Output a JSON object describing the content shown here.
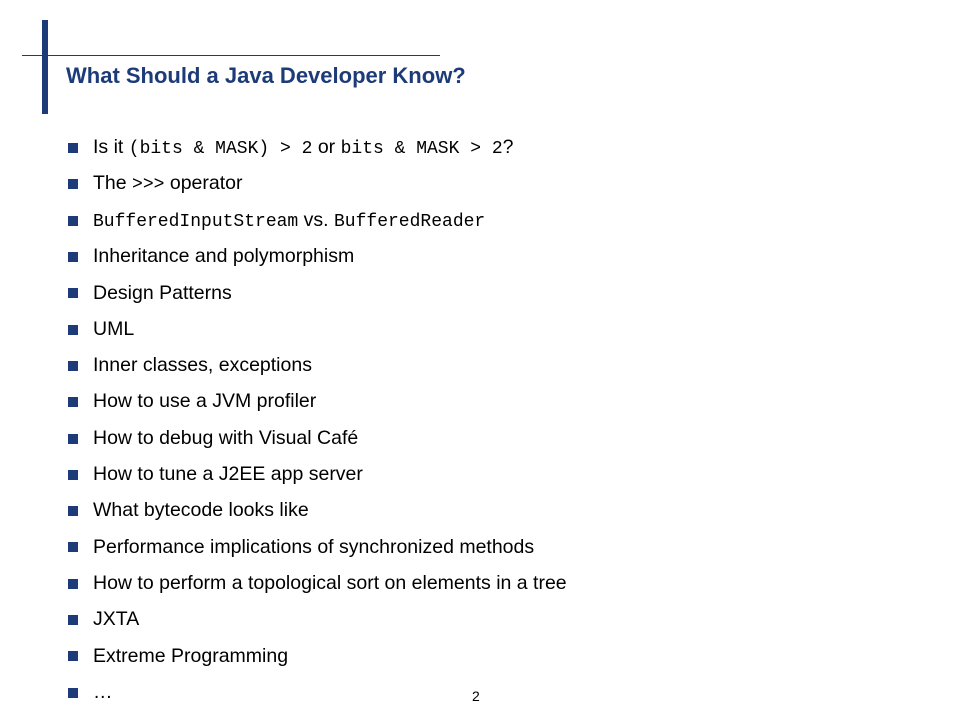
{
  "slide": {
    "title": "What Should a Java Developer Know?",
    "page_number": "2",
    "accent_color": "#1c3b78",
    "bullets": [
      {
        "parts": [
          {
            "text": "Is it ",
            "mono": false
          },
          {
            "text": "(bits & MASK) > 2",
            "mono": true
          },
          {
            "text": " or ",
            "mono": false
          },
          {
            "text": "bits & MASK > 2",
            "mono": true
          },
          {
            "text": "?",
            "mono": false
          }
        ]
      },
      {
        "parts": [
          {
            "text": "The ",
            "mono": false
          },
          {
            "text": ">>>",
            "mono": true
          },
          {
            "text": " operator",
            "mono": false
          }
        ]
      },
      {
        "parts": [
          {
            "text": "BufferedInputStream",
            "mono": true
          },
          {
            "text": " vs. ",
            "mono": false
          },
          {
            "text": "BufferedReader",
            "mono": true
          }
        ]
      },
      {
        "parts": [
          {
            "text": "Inheritance and polymorphism",
            "mono": false
          }
        ]
      },
      {
        "parts": [
          {
            "text": "Design Patterns",
            "mono": false
          }
        ]
      },
      {
        "parts": [
          {
            "text": "UML",
            "mono": false
          }
        ]
      },
      {
        "parts": [
          {
            "text": "Inner classes, exceptions",
            "mono": false
          }
        ]
      },
      {
        "parts": [
          {
            "text": "How to use a JVM profiler",
            "mono": false
          }
        ]
      },
      {
        "parts": [
          {
            "text": "How to debug with Visual Café",
            "mono": false
          }
        ]
      },
      {
        "parts": [
          {
            "text": "How to tune a J2EE app server",
            "mono": false
          }
        ]
      },
      {
        "parts": [
          {
            "text": "What bytecode looks like",
            "mono": false
          }
        ]
      },
      {
        "parts": [
          {
            "text": "Performance implications of synchronized methods",
            "mono": false
          }
        ]
      },
      {
        "parts": [
          {
            "text": "How to perform a topological sort on elements in a tree",
            "mono": false
          }
        ]
      },
      {
        "parts": [
          {
            "text": "JXTA",
            "mono": false
          }
        ]
      },
      {
        "parts": [
          {
            "text": "Extreme Programming",
            "mono": false
          }
        ]
      },
      {
        "parts": [
          {
            "text": "…",
            "mono": false
          }
        ]
      }
    ]
  }
}
